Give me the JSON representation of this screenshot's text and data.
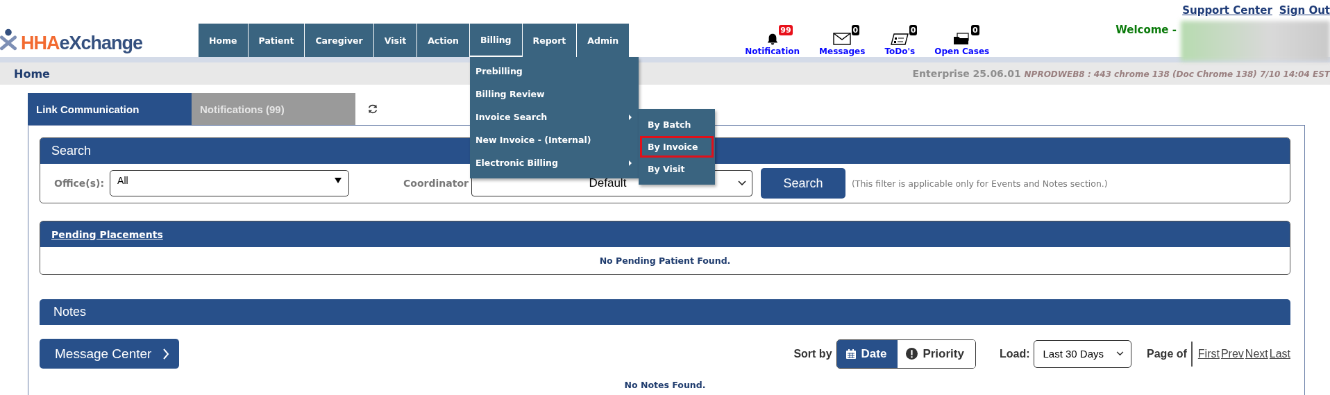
{
  "logo": {
    "brand_1": "HHA",
    "brand_2": "eXchange"
  },
  "nav": [
    {
      "label": "Home",
      "open": false
    },
    {
      "label": "Patient",
      "open": false
    },
    {
      "label": "Caregiver",
      "open": false
    },
    {
      "label": "Visit",
      "open": false
    },
    {
      "label": "Action",
      "open": false
    },
    {
      "label": "Billing",
      "open": true
    },
    {
      "label": "Report",
      "open": false
    },
    {
      "label": "Admin",
      "open": false
    }
  ],
  "billing_menu": [
    {
      "label": "Prebilling",
      "has_submenu": false
    },
    {
      "label": "Billing Review",
      "has_submenu": false
    },
    {
      "label": "Invoice Search",
      "has_submenu": true
    },
    {
      "label": "New Invoice - (Internal)",
      "has_submenu": false
    },
    {
      "label": "Electronic Billing",
      "has_submenu": true
    }
  ],
  "invoice_search_submenu": [
    {
      "label": "By Batch",
      "selected": false
    },
    {
      "label": "By Invoice",
      "selected": true
    },
    {
      "label": "By Visit",
      "selected": false
    }
  ],
  "alerts": [
    {
      "kind": "bell",
      "label": "Notification",
      "count": "99"
    },
    {
      "kind": "envelope",
      "label": "Messages",
      "count": "0"
    },
    {
      "kind": "todo",
      "label": "ToDo's",
      "count": "0"
    },
    {
      "kind": "folder",
      "label": "Open Cases",
      "count": "0"
    }
  ],
  "top_links": [
    "Support Center",
    "Sign Out"
  ],
  "welcome": "Welcome -",
  "breadcrumb": "Home",
  "version": {
    "product": "Enterprise 25.06.01",
    "detail": "NPRODWEB8 : 443 chrome 138 (Doc Chrome 138) 7/10 14:04 EST"
  },
  "tabs": [
    {
      "label": "Link Communication",
      "selected": true
    },
    {
      "label": "Notifications (99)",
      "selected": false
    }
  ],
  "search": {
    "title": "Search",
    "office_label": "Office(s):",
    "office_value": "All",
    "coordinator_label": "Coordinator",
    "coordinator_value": "Default",
    "button": "Search",
    "note": "(This filter is applicable only for Events and Notes section.)"
  },
  "pending": {
    "title": "Pending Placements",
    "empty": "No Pending Patient Found."
  },
  "notes": {
    "title": "Notes",
    "message_center": "Message Center",
    "sort_label": "Sort by",
    "sort_options": [
      {
        "label": "Date",
        "kind": "calendar",
        "selected": true
      },
      {
        "label": "Priority",
        "kind": "alert",
        "selected": false
      }
    ],
    "load_label": "Load:",
    "load_value": "Last 30 Days",
    "page_label": "Page of",
    "pager": [
      "First",
      "Prev",
      "Next",
      "Last"
    ],
    "empty": "No Notes Found."
  }
}
